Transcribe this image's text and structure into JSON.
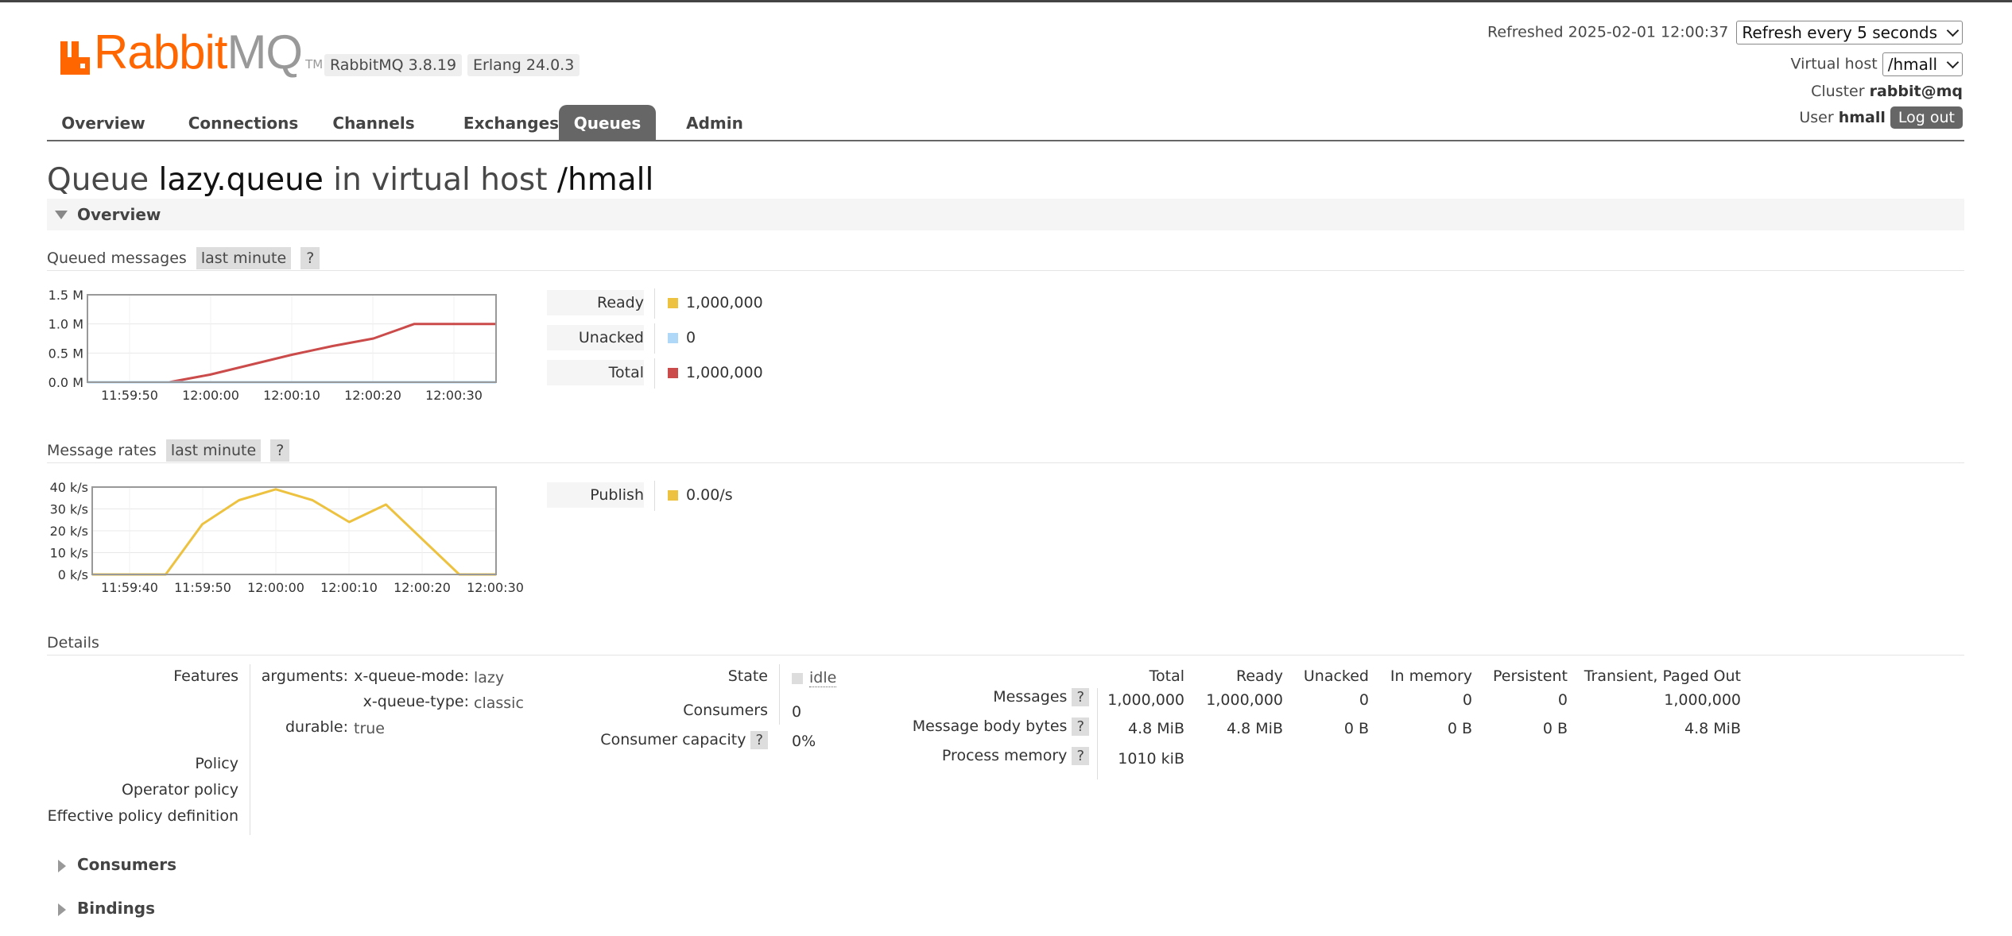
{
  "header": {
    "logo_text_rabbit": "Rabbit",
    "logo_text_mq": "MQ",
    "logo_tm": "TM",
    "version": "RabbitMQ 3.8.19",
    "erlang": "Erlang 24.0.3",
    "refreshed_label": "Refreshed 2025-02-01 12:00:37",
    "refresh_select": "Refresh every 5 seconds",
    "vhost_label": "Virtual host",
    "vhost_value": "/hmall",
    "cluster_label": "Cluster",
    "cluster_value": "rabbit@mq",
    "user_label": "User",
    "user_value": "hmall",
    "logout": "Log out"
  },
  "nav": {
    "tabs": [
      "Overview",
      "Connections",
      "Channels",
      "Exchanges",
      "Queues",
      "Admin"
    ],
    "active": "Queues"
  },
  "title": {
    "prefix": "Queue",
    "queue": "lazy.queue",
    "mid": "in virtual host",
    "vhost": "/hmall"
  },
  "overview_section": "Overview",
  "queued": {
    "label": "Queued messages",
    "range": "last minute",
    "help": "?",
    "legend": [
      {
        "label": "Ready",
        "value": "1,000,000",
        "color": "#edc240"
      },
      {
        "label": "Unacked",
        "value": "0",
        "color": "#afd8f8"
      },
      {
        "label": "Total",
        "value": "1,000,000",
        "color": "#cb4b4b"
      }
    ]
  },
  "rates": {
    "label": "Message rates",
    "range": "last minute",
    "help": "?",
    "legend": [
      {
        "label": "Publish",
        "value": "0.00/s",
        "color": "#edc240"
      }
    ]
  },
  "chart_data": [
    {
      "type": "line",
      "x": [
        "11:59:46",
        "11:59:50",
        "11:59:55",
        "12:00:00",
        "12:00:05",
        "12:00:10",
        "12:00:15",
        "12:00:20",
        "12:00:25",
        "12:00:30",
        "12:00:35"
      ],
      "x_ticks": [
        "11:59:50",
        "12:00:00",
        "12:00:10",
        "12:00:20",
        "12:00:30"
      ],
      "y_ticks": [
        "0.0 M",
        "0.5 M",
        "1.0 M",
        "1.5 M"
      ],
      "ylim": [
        0,
        1.5
      ],
      "series": [
        {
          "name": "Total",
          "color": "#cb4b4b",
          "values": [
            0,
            0,
            0,
            0.13,
            0.3,
            0.47,
            0.62,
            0.75,
            1.0,
            1.0,
            1.0
          ]
        },
        {
          "name": "Unacked",
          "color": "#afd8f8",
          "values": [
            0,
            0,
            0,
            0,
            0,
            0,
            0,
            0,
            0,
            0,
            0
          ]
        }
      ]
    },
    {
      "type": "line",
      "x": [
        "11:59:36",
        "11:59:40",
        "11:59:45",
        "11:59:50",
        "11:59:55",
        "12:00:00",
        "12:00:05",
        "12:00:10",
        "12:00:15",
        "12:00:20",
        "12:00:25",
        "12:00:30"
      ],
      "x_ticks": [
        "11:59:40",
        "11:59:50",
        "12:00:00",
        "12:00:10",
        "12:00:20",
        "12:00:30"
      ],
      "y_ticks": [
        "0 k/s",
        "10 k/s",
        "20 k/s",
        "30 k/s",
        "40 k/s"
      ],
      "ylim": [
        0,
        40
      ],
      "series": [
        {
          "name": "Publish",
          "color": "#edc240",
          "values": [
            0,
            0,
            0,
            23,
            34,
            39,
            34,
            24,
            32,
            16,
            0,
            0
          ]
        }
      ]
    }
  ],
  "details": {
    "heading": "Details",
    "features_label": "Features",
    "arguments_label": "arguments:",
    "args": [
      {
        "key": "x-queue-mode:",
        "value": "lazy"
      },
      {
        "key": "x-queue-type:",
        "value": "classic"
      }
    ],
    "durable_label": "durable:",
    "durable_value": "true",
    "policy_label": "Policy",
    "operator_policy_label": "Operator policy",
    "effective_policy_label": "Effective policy definition",
    "state_label": "State",
    "state_value": "idle",
    "consumers_label": "Consumers",
    "consumers_value": "0",
    "capacity_label": "Consumer capacity",
    "capacity_value": "0%",
    "help": "?",
    "stats_headers": [
      "Total",
      "Ready",
      "Unacked",
      "In memory",
      "Persistent",
      "Transient, Paged Out"
    ],
    "stats_rows": [
      {
        "label": "Messages",
        "values": [
          "1,000,000",
          "1,000,000",
          "0",
          "0",
          "0",
          "1,000,000"
        ]
      },
      {
        "label": "Message body bytes",
        "values": [
          "4.8 MiB",
          "4.8 MiB",
          "0 B",
          "0 B",
          "0 B",
          "4.8 MiB"
        ]
      },
      {
        "label": "Process memory",
        "values": [
          "1010 kiB"
        ]
      }
    ]
  },
  "collapsed_sections": [
    "Consumers",
    "Bindings"
  ]
}
